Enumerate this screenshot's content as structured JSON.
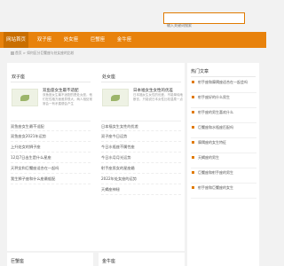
{
  "search": {
    "placeholder": "输入关键词搜索"
  },
  "nav": {
    "items": [
      "网站首页",
      "双子座",
      "处女座",
      "巨蟹座",
      "金牛座"
    ]
  },
  "breadcrumb": {
    "text": "首页 > 如何区分巨蟹座与处女座的比较"
  },
  "sections": [
    {
      "title": "双子座",
      "featured": {
        "title": "双鱼座女生最不适配",
        "desc": "双鱼座女生最不适配的是处女座，他们在性格方面差异很大，两人相处常常会一有矛盾便会产生"
      },
      "items": [
        "双鱼座女生最不适配",
        "双鱼座女2021年运势",
        "上升处女的狮子座",
        "12月7日出生是什么星座",
        "天秤女和巨蟹座适合在一起吗",
        "我生狮子座和什么座最般配"
      ]
    },
    {
      "title": "处女座",
      "featured": {
        "title": "日本福女生女性的优差",
        "desc": "日本福女生女性的优差，不能单纯地断言，只能说日本女性比较温柔一点"
      },
      "items": [
        "日本福女生女性的优差",
        "双子座今日运势",
        "今日水瓶座不属性座",
        "今日水月月光运势",
        "射手座男女的星座婚",
        "2022年处女座的运势",
        "天蝎座神秘"
      ]
    }
  ],
  "sidebar": {
    "title": "热门文章",
    "items": [
      "射手座和摩羯座适合在一起会吗",
      "射手座好的什么男生",
      "射手座的男生喜欢什么",
      "巨蟹座和水瓶座匹配吗",
      "摩羯座的女生特征",
      "天蝎座的男生",
      "巨蟹座和射手座的男生",
      "射手座和巨蟹座的女生"
    ]
  },
  "bottom": {
    "left_title": "巨蟹座",
    "right_title": "金牛座"
  }
}
